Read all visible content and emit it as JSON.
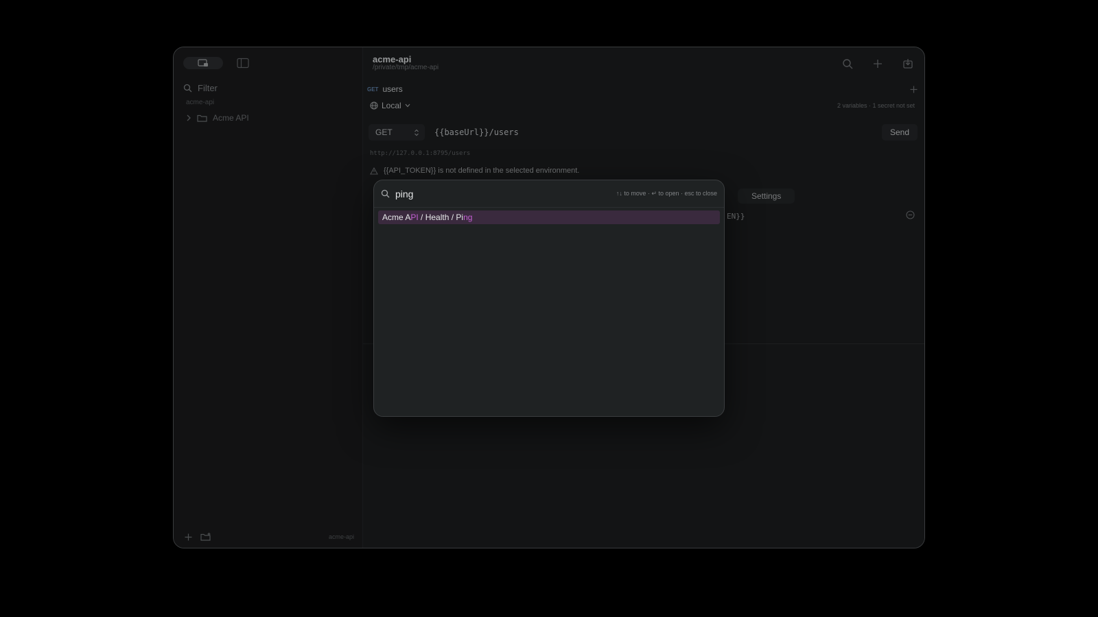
{
  "sidebar": {
    "filter_placeholder": "Filter",
    "workspace_label": "acme-api",
    "tree": [
      {
        "label": "Acme API"
      }
    ],
    "footer_workspace": "acme-api"
  },
  "header": {
    "project_name": "acme-api",
    "project_path": "/private/tmp/acme-api"
  },
  "tab": {
    "method": "GET",
    "name": "users"
  },
  "environment": {
    "name": "Local",
    "status": "2 variables · 1 secret not set"
  },
  "request": {
    "method": "GET",
    "url": "{{baseUrl}}/users",
    "send_label": "Send",
    "resolved_url": "http://127.0.0.1:8795/users",
    "warning": "{{API_TOKEN}} is not defined in the selected environment.",
    "settings_tab": "Settings",
    "header_value_fragment": "EN}}"
  },
  "palette": {
    "query": "ping",
    "hint": "↑↓ to move · ↵ to open · esc to close",
    "results": [
      {
        "segments": [
          {
            "text": "Acme A",
            "hl": false
          },
          {
            "text": "PI",
            "hl": true
          },
          {
            "text": " / Health / Pi",
            "hl": false
          },
          {
            "text": "ng",
            "hl": true
          }
        ]
      }
    ]
  },
  "colors": {
    "accent_highlight": "#c35fd3",
    "selected_row": "#3a2a3e"
  }
}
